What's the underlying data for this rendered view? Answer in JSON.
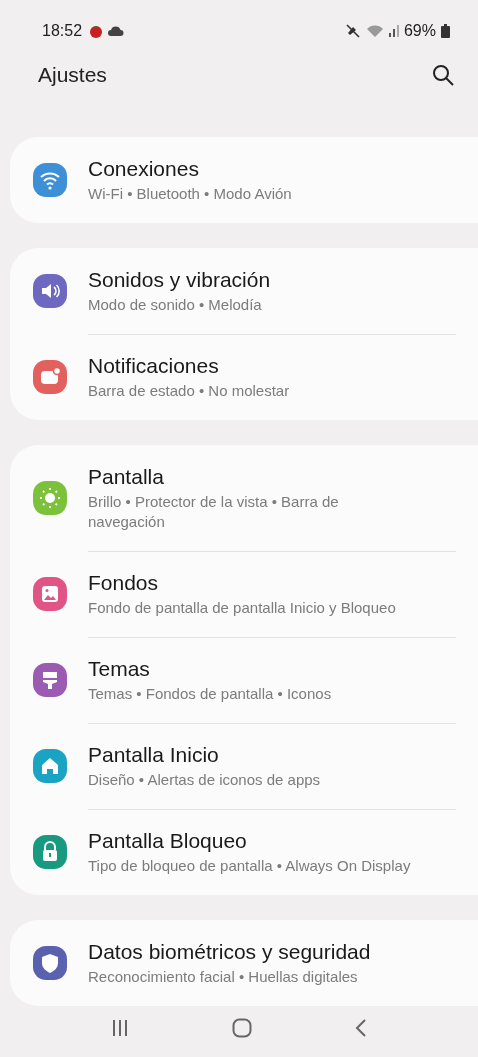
{
  "status_bar": {
    "time": "18:52",
    "battery": "69%"
  },
  "header": {
    "title": "Ajustes"
  },
  "groups": [
    {
      "items": [
        {
          "kind": "wifi",
          "color": "#3d8fd8",
          "title": "Conexiones",
          "subtitle": "Wi-Fi • Bluetooth • Modo Avión"
        }
      ]
    },
    {
      "items": [
        {
          "kind": "sound",
          "color": "#6f68c0",
          "title": "Sonidos y vibración",
          "subtitle": "Modo de sonido • Melodía"
        },
        {
          "kind": "notification",
          "color": "#e2615e",
          "title": "Notificaciones",
          "subtitle": "Barra de estado • No molestar"
        }
      ]
    },
    {
      "items": [
        {
          "kind": "sun",
          "color": "#7cc13a",
          "title": "Pantalla",
          "subtitle": "Brillo • Protector de la vista • Barra de navegación"
        },
        {
          "kind": "image",
          "color": "#e05584",
          "title": "Fondos",
          "subtitle": "Fondo de pantalla de pantalla Inicio y Bloqueo"
        },
        {
          "kind": "brush",
          "color": "#9b5bb3",
          "title": "Temas",
          "subtitle": "Temas • Fondos de pantalla • Iconos"
        },
        {
          "kind": "home",
          "color": "#1ba3c4",
          "title": "Pantalla Inicio",
          "subtitle": "Diseño • Alertas de iconos de apps"
        },
        {
          "kind": "lock",
          "color": "#179a80",
          "title": "Pantalla Bloqueo",
          "subtitle": "Tipo de bloqueo de pantalla • Always On Display"
        }
      ]
    },
    {
      "items": [
        {
          "kind": "shield",
          "color": "#5a62b0",
          "title": "Datos biométricos y seguridad",
          "subtitle": "Reconocimiento facial • Huellas digitales"
        }
      ]
    }
  ]
}
